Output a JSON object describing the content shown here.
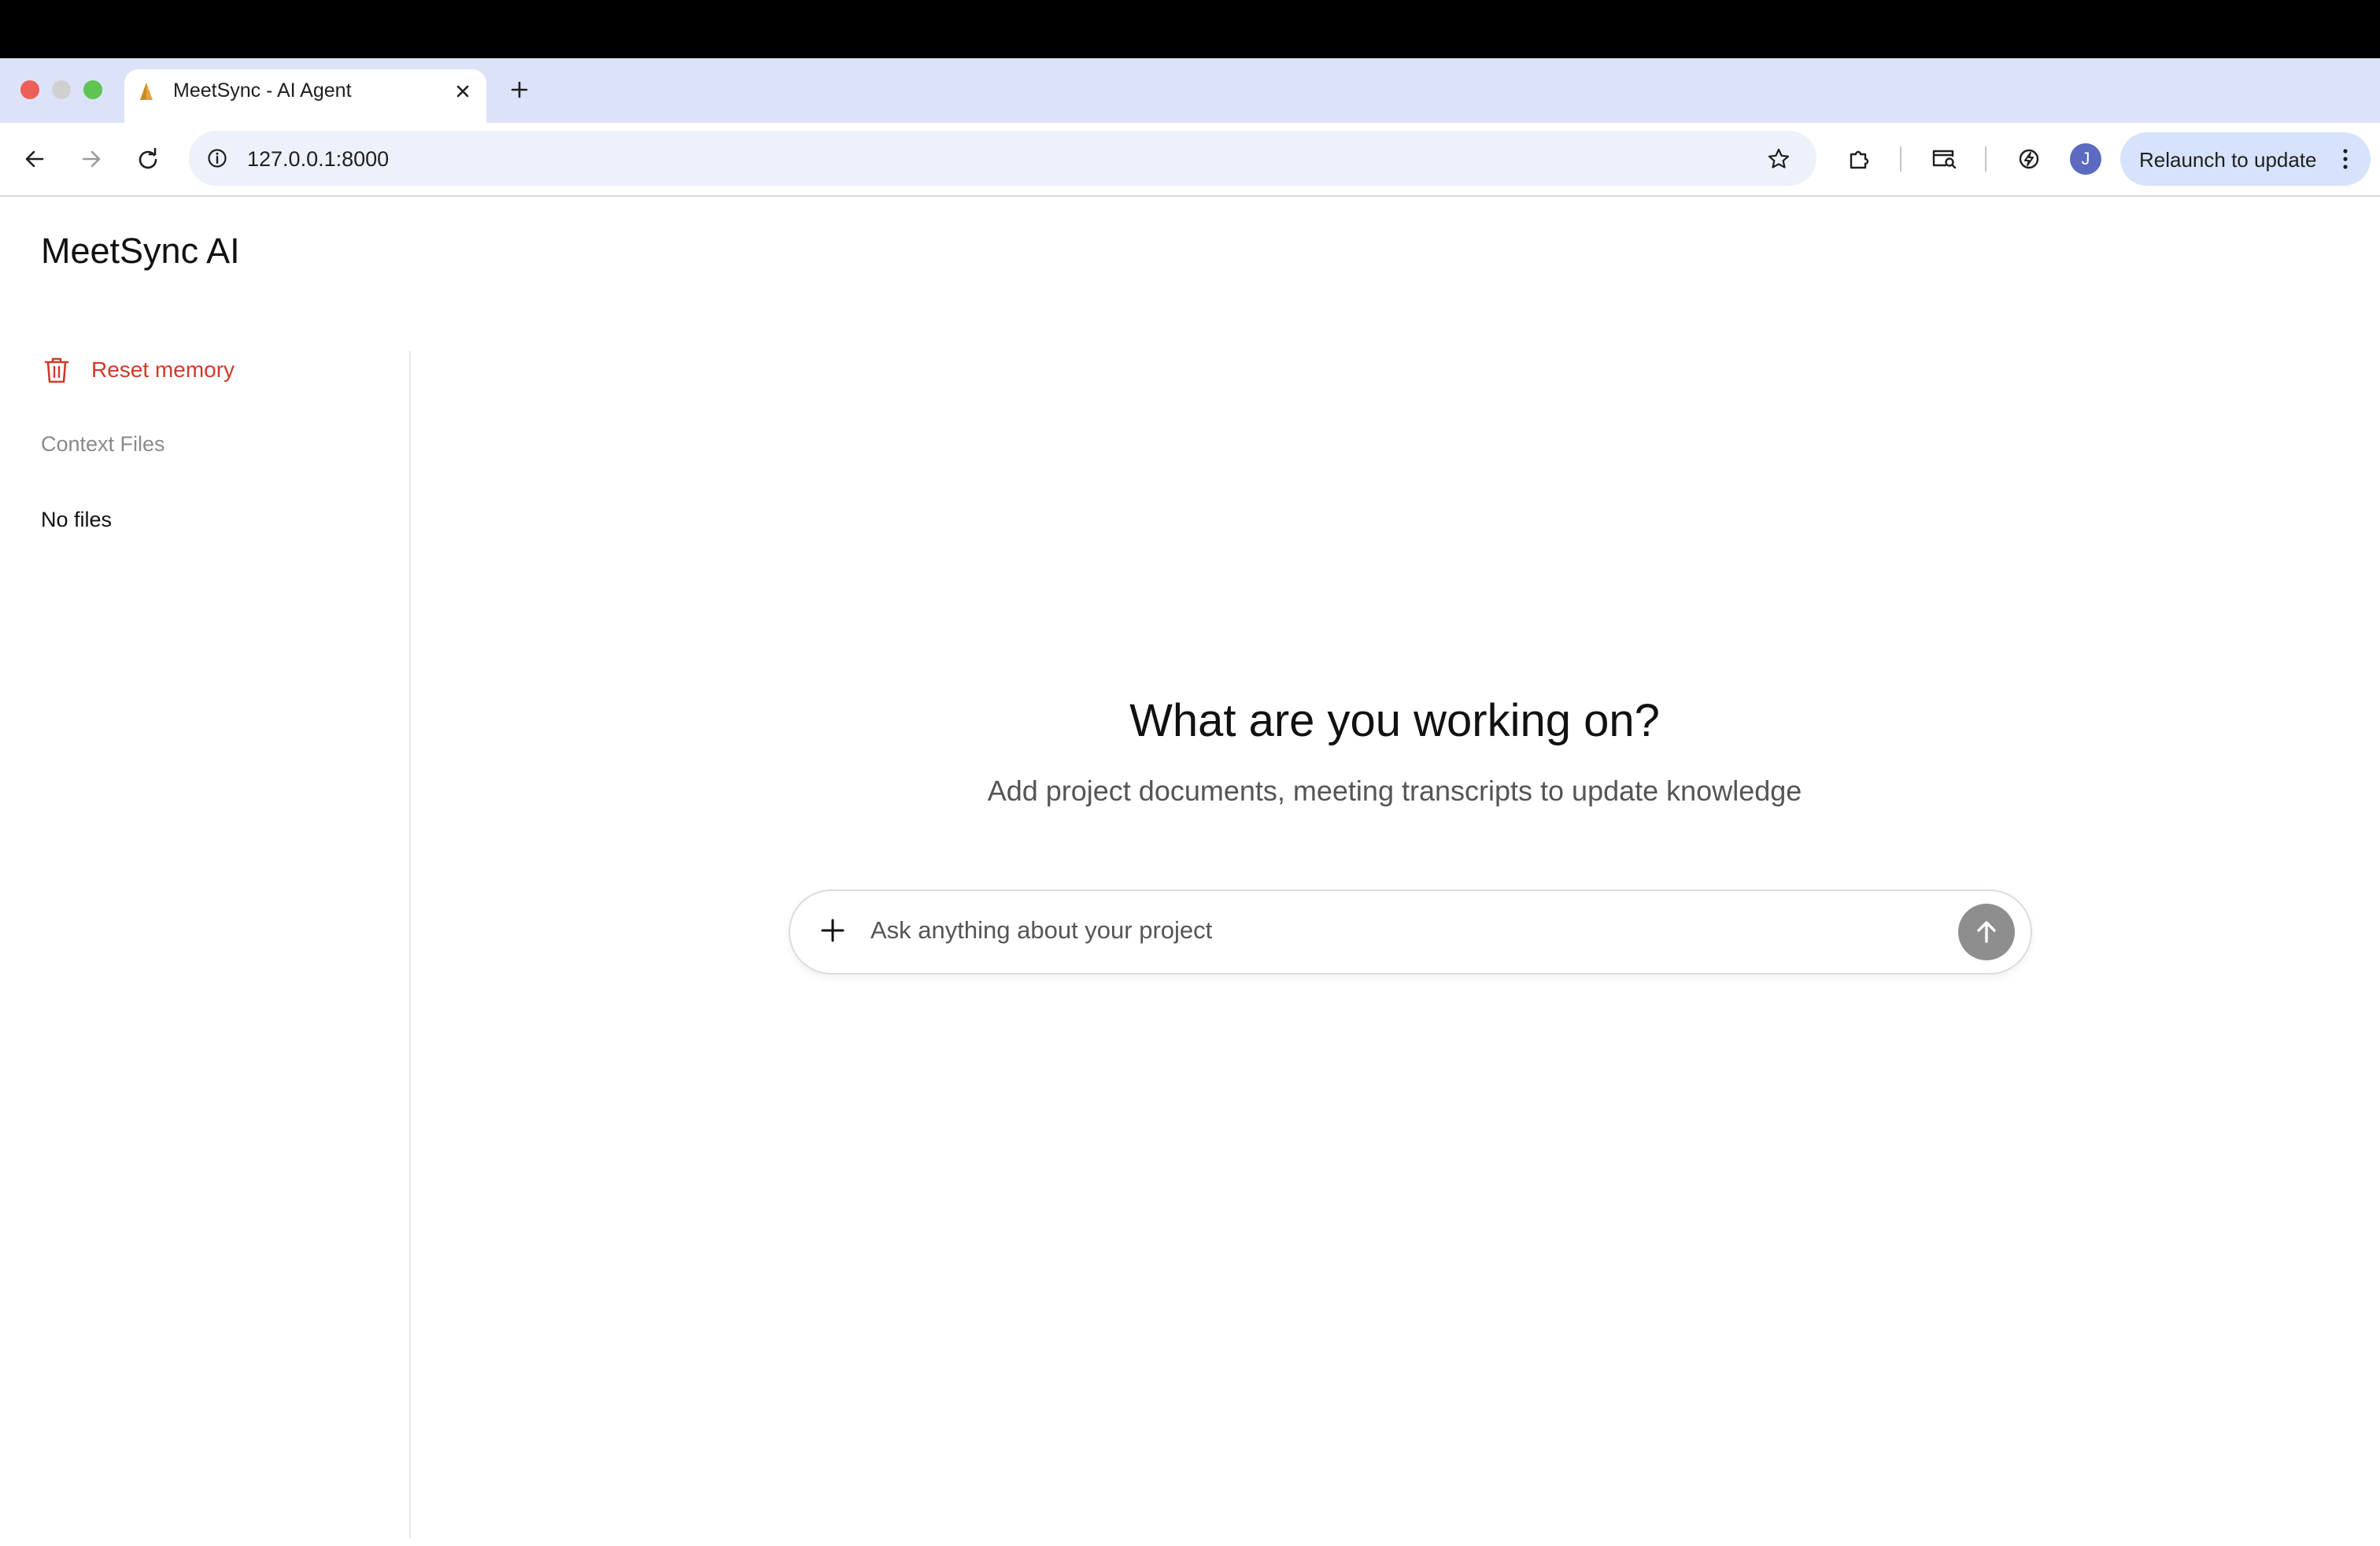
{
  "browser": {
    "tab_title": "MeetSync - AI Agent",
    "new_tab_icon": "plus-icon",
    "url": "127.0.0.1:8000",
    "profile_initial": "J",
    "relaunch_label": "Relaunch to update",
    "colors": {
      "tabstrip": "#dce3f9",
      "omnibox": "#edf1fa",
      "relaunch_pill": "#d7e3fc",
      "avatar": "#5c6bc0"
    }
  },
  "app": {
    "logo": "MeetSync AI"
  },
  "sidebar": {
    "reset_label": "Reset memory",
    "reset_icon": "trash-icon",
    "context_heading": "Context Files",
    "empty_text": "No files"
  },
  "main": {
    "title": "What are you working on?",
    "subtitle": "Add project documents, meeting transcripts to update knowledge",
    "composer": {
      "placeholder": "Ask anything about your project",
      "value": "",
      "attach_icon": "plus-icon",
      "send_icon": "arrow-up-icon"
    }
  },
  "colors": {
    "danger": "#d03a2b",
    "send_button": "#8e8e8e",
    "muted_text": "#8a8a8a"
  }
}
